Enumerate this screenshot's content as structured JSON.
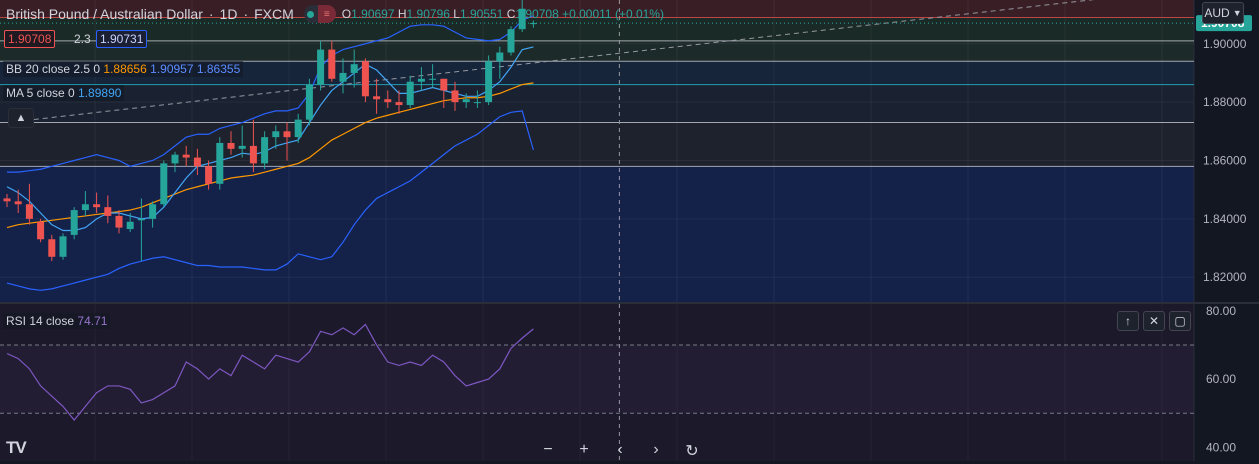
{
  "header": {
    "symbol": "British Pound / Australian Dollar",
    "interval": "1D",
    "exchange": "FXCM",
    "open_label": "O",
    "open": "1.90697",
    "high_label": "H",
    "high": "1.90796",
    "low_label": "L",
    "low": "1.90551",
    "close_label": "C",
    "close": "1.90708",
    "change": "+0.00011 (+0.01%)"
  },
  "quote": {
    "bid": "1.90708",
    "spread": "2.3",
    "ask": "1.90731"
  },
  "indicators": {
    "bb": {
      "label": "BB 20 close 2.5 0",
      "basis": "1.88656",
      "upper": "1.90957",
      "lower": "1.86355"
    },
    "ma": {
      "label": "MA 5 close 0",
      "value": "1.89890"
    },
    "rsi": {
      "label": "RSI 14 close",
      "value": "74.71"
    }
  },
  "currency_button": "AUD",
  "colors": {
    "up": "#26a69a",
    "down": "#ef5350",
    "bb_band": "#2962ff",
    "bb_basis": "#ff9800",
    "ma": "#42a5f5",
    "rsi": "#7e57c2",
    "price_tag": "#26a69a"
  },
  "icons": {
    "logo": "tradingview-logo",
    "collapse": "chevron-up-icon",
    "currency": "chevron-down-icon",
    "rsi_tools": [
      "arrow-up-icon",
      "close-icon",
      "maximize-icon"
    ],
    "nav": [
      "zoom-out-icon",
      "zoom-in-icon",
      "scroll-left-icon",
      "scroll-right-icon",
      "reset-icon"
    ]
  },
  "logo_text": "TV",
  "chart_data": [
    {
      "type": "candlestick",
      "ylim": [
        1.8115,
        1.915
      ],
      "yticks": [
        "1.90000",
        "1.88000",
        "1.86000",
        "1.84000",
        "1.82000"
      ],
      "last_price": "1.90708",
      "candles": [
        [
          1.847,
          1.8485,
          1.844,
          1.846
        ],
        [
          1.846,
          1.85,
          1.842,
          1.845
        ],
        [
          1.845,
          1.852,
          1.838,
          1.84
        ],
        [
          1.839,
          1.84,
          1.832,
          1.833
        ],
        [
          1.833,
          1.8345,
          1.8255,
          1.827
        ],
        [
          1.827,
          1.835,
          1.826,
          1.834
        ],
        [
          1.8345,
          1.844,
          1.833,
          1.843
        ],
        [
          1.843,
          1.8495,
          1.841,
          1.845
        ],
        [
          1.845,
          1.849,
          1.842,
          1.844
        ],
        [
          1.844,
          1.848,
          1.8385,
          1.841
        ],
        [
          1.841,
          1.843,
          1.835,
          1.837
        ],
        [
          1.8365,
          1.842,
          1.8355,
          1.839
        ],
        [
          1.8395,
          1.847,
          1.8255,
          1.84
        ],
        [
          1.84,
          1.846,
          1.837,
          1.845
        ],
        [
          1.845,
          1.86,
          1.844,
          1.859
        ],
        [
          1.859,
          1.863,
          1.856,
          1.862
        ],
        [
          1.862,
          1.865,
          1.858,
          1.861
        ],
        [
          1.861,
          1.864,
          1.855,
          1.858
        ],
        [
          1.858,
          1.86,
          1.85,
          1.852
        ],
        [
          1.852,
          1.868,
          1.85,
          1.866
        ],
        [
          1.866,
          1.87,
          1.862,
          1.864
        ],
        [
          1.864,
          1.872,
          1.861,
          1.865
        ],
        [
          1.865,
          1.874,
          1.856,
          1.859
        ],
        [
          1.859,
          1.87,
          1.857,
          1.868
        ],
        [
          1.868,
          1.872,
          1.864,
          1.87
        ],
        [
          1.87,
          1.873,
          1.86,
          1.868
        ],
        [
          1.868,
          1.876,
          1.866,
          1.874
        ],
        [
          1.874,
          1.888,
          1.872,
          1.886
        ],
        [
          1.886,
          1.901,
          1.884,
          1.898
        ],
        [
          1.898,
          1.901,
          1.887,
          1.888
        ],
        [
          1.887,
          1.895,
          1.883,
          1.89
        ],
        [
          1.89,
          1.898,
          1.885,
          1.893
        ],
        [
          1.894,
          1.895,
          1.88,
          1.882
        ],
        [
          1.882,
          1.888,
          1.876,
          1.881
        ],
        [
          1.881,
          1.884,
          1.878,
          1.88
        ],
        [
          1.88,
          1.884,
          1.876,
          1.879
        ],
        [
          1.879,
          1.889,
          1.878,
          1.887
        ],
        [
          1.887,
          1.892,
          1.884,
          1.888
        ],
        [
          1.888,
          1.893,
          1.885,
          1.888
        ],
        [
          1.888,
          1.888,
          1.878,
          1.884
        ],
        [
          1.884,
          1.887,
          1.877,
          1.88
        ],
        [
          1.88,
          1.883,
          1.878,
          1.881
        ],
        [
          1.88,
          1.884,
          1.878,
          1.88
        ],
        [
          1.88,
          1.896,
          1.879,
          1.894
        ],
        [
          1.894,
          1.899,
          1.888,
          1.897
        ],
        [
          1.897,
          1.906,
          1.896,
          1.905
        ],
        [
          1.905,
          1.915,
          1.904,
          1.912
        ],
        [
          1.90697,
          1.90796,
          1.90551,
          1.90708
        ]
      ],
      "bb_upper": [
        1.856,
        1.856,
        1.8565,
        1.857,
        1.858,
        1.859,
        1.86,
        1.861,
        1.862,
        1.861,
        1.86,
        1.858,
        1.859,
        1.86,
        1.862,
        1.865,
        1.868,
        1.869,
        1.869,
        1.871,
        1.872,
        1.873,
        1.8745,
        1.876,
        1.877,
        1.877,
        1.878,
        1.883,
        1.892,
        1.896,
        1.898,
        1.899,
        1.9,
        1.901,
        1.902,
        1.904,
        1.906,
        1.9065,
        1.9065,
        1.906,
        1.904,
        1.902,
        1.9015,
        1.901,
        1.9015,
        1.904,
        1.908,
        1.9096
      ],
      "bb_basis": [
        1.837,
        1.838,
        1.8385,
        1.839,
        1.8395,
        1.84,
        1.8405,
        1.841,
        1.8415,
        1.842,
        1.8425,
        1.843,
        1.844,
        1.8455,
        1.847,
        1.8485,
        1.85,
        1.851,
        1.852,
        1.853,
        1.854,
        1.8545,
        1.855,
        1.856,
        1.857,
        1.858,
        1.859,
        1.861,
        1.864,
        1.867,
        1.869,
        1.871,
        1.873,
        1.8745,
        1.8755,
        1.8765,
        1.8775,
        1.8785,
        1.8795,
        1.8805,
        1.881,
        1.8815,
        1.8815,
        1.882,
        1.883,
        1.8845,
        1.886,
        1.8866
      ],
      "bb_lower": [
        1.818,
        1.817,
        1.816,
        1.8155,
        1.816,
        1.817,
        1.818,
        1.819,
        1.82,
        1.821,
        1.823,
        1.8245,
        1.8255,
        1.8265,
        1.827,
        1.826,
        1.825,
        1.824,
        1.824,
        1.8235,
        1.8235,
        1.8235,
        1.823,
        1.8225,
        1.8225,
        1.8245,
        1.828,
        1.827,
        1.826,
        1.827,
        1.832,
        1.838,
        1.843,
        1.847,
        1.849,
        1.851,
        1.853,
        1.856,
        1.859,
        1.862,
        1.865,
        1.867,
        1.869,
        1.872,
        1.875,
        1.8765,
        1.877,
        1.8636
      ],
      "ma5": [
        1.851,
        1.849,
        1.846,
        1.842,
        1.838,
        1.836,
        1.836,
        1.837,
        1.84,
        1.842,
        1.842,
        1.841,
        1.84,
        1.8405,
        1.844,
        1.849,
        1.854,
        1.858,
        1.859,
        1.86,
        1.861,
        1.8625,
        1.862,
        1.863,
        1.865,
        1.866,
        1.867,
        1.873,
        1.879,
        1.884,
        1.887,
        1.89,
        1.893,
        1.891,
        1.887,
        1.883,
        1.883,
        1.884,
        1.885,
        1.884,
        1.883,
        1.882,
        1.882,
        1.884,
        1.887,
        1.892,
        1.898,
        1.8989
      ],
      "horizontal_levels": [
        1.909,
        1.901,
        1.894,
        1.886,
        1.873,
        1.858
      ],
      "trendline": [
        [
          0,
          1.873
        ],
        [
          66,
          1.915
        ]
      ],
      "crosshair_x_index": 52
    },
    {
      "type": "line",
      "name": "RSI 14 close",
      "ylim": [
        36,
        82
      ],
      "yticks": [
        "80.00",
        "60.00",
        "40.00"
      ],
      "guide_levels": [
        70,
        50
      ],
      "values": [
        67.5,
        66,
        63,
        58,
        55,
        52,
        48,
        52,
        56,
        58,
        58,
        57,
        53,
        54,
        56,
        58,
        65,
        63,
        60,
        63,
        61,
        67,
        65,
        63,
        67,
        66,
        65,
        68,
        74,
        73,
        75,
        73,
        76,
        70,
        65,
        64,
        65,
        64,
        67,
        65,
        61,
        58,
        59,
        60,
        63,
        69,
        72,
        74.71
      ]
    }
  ]
}
